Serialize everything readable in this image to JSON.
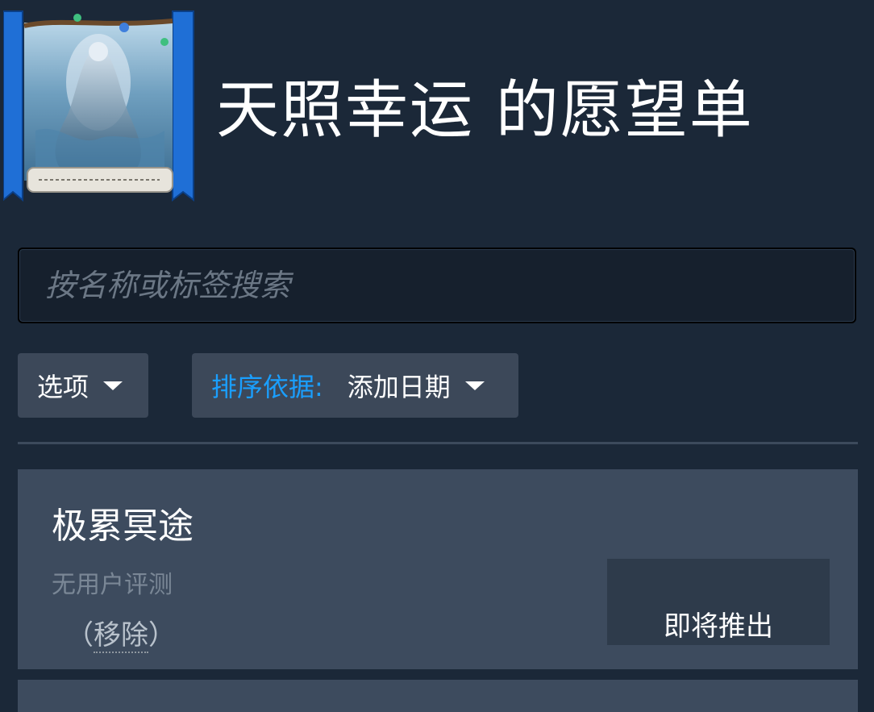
{
  "header": {
    "title": "天照幸运 的愿望单"
  },
  "search": {
    "placeholder": "按名称或标签搜索",
    "value": ""
  },
  "filters": {
    "options_label": "选项",
    "sort_label": "排序依据:",
    "sort_value": "添加日期"
  },
  "items": [
    {
      "title": "极累冥途",
      "reviews": "无用户评测",
      "remove_open": "（",
      "remove_label": "移除",
      "remove_close": "）",
      "release": "即将推出"
    }
  ],
  "colors": {
    "background": "#1b2838",
    "accent": "#1a9fff",
    "card": "#3d4b5e",
    "dropdown": "#3c4859"
  }
}
